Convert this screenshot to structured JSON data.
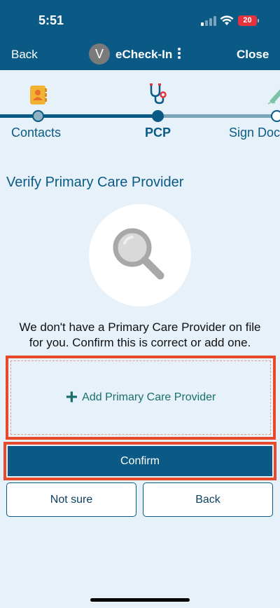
{
  "status_bar": {
    "time": "5:51",
    "battery": "20"
  },
  "nav": {
    "back_label": "Back",
    "avatar_initial": "V",
    "title": "eCheck-In",
    "close_label": "Close"
  },
  "steps": [
    {
      "label": "Contacts",
      "icon": "contacts-book-icon"
    },
    {
      "label": "PCP",
      "icon": "stethoscope-icon"
    },
    {
      "label": "Sign Doc",
      "icon": "pen-icon"
    }
  ],
  "main": {
    "title": "Verify Primary Care Provider",
    "message_line1": "We don't have a Primary Care Provider on file",
    "message_line2": "for you. Confirm this is correct or add one.",
    "add_label": "Add Primary Care Provider",
    "confirm_label": "Confirm",
    "not_sure_label": "Not sure",
    "back_label": "Back"
  },
  "colors": {
    "brand": "#0b5a86",
    "accent_highlight": "#e8492a",
    "add_text": "#1b6f6a"
  }
}
